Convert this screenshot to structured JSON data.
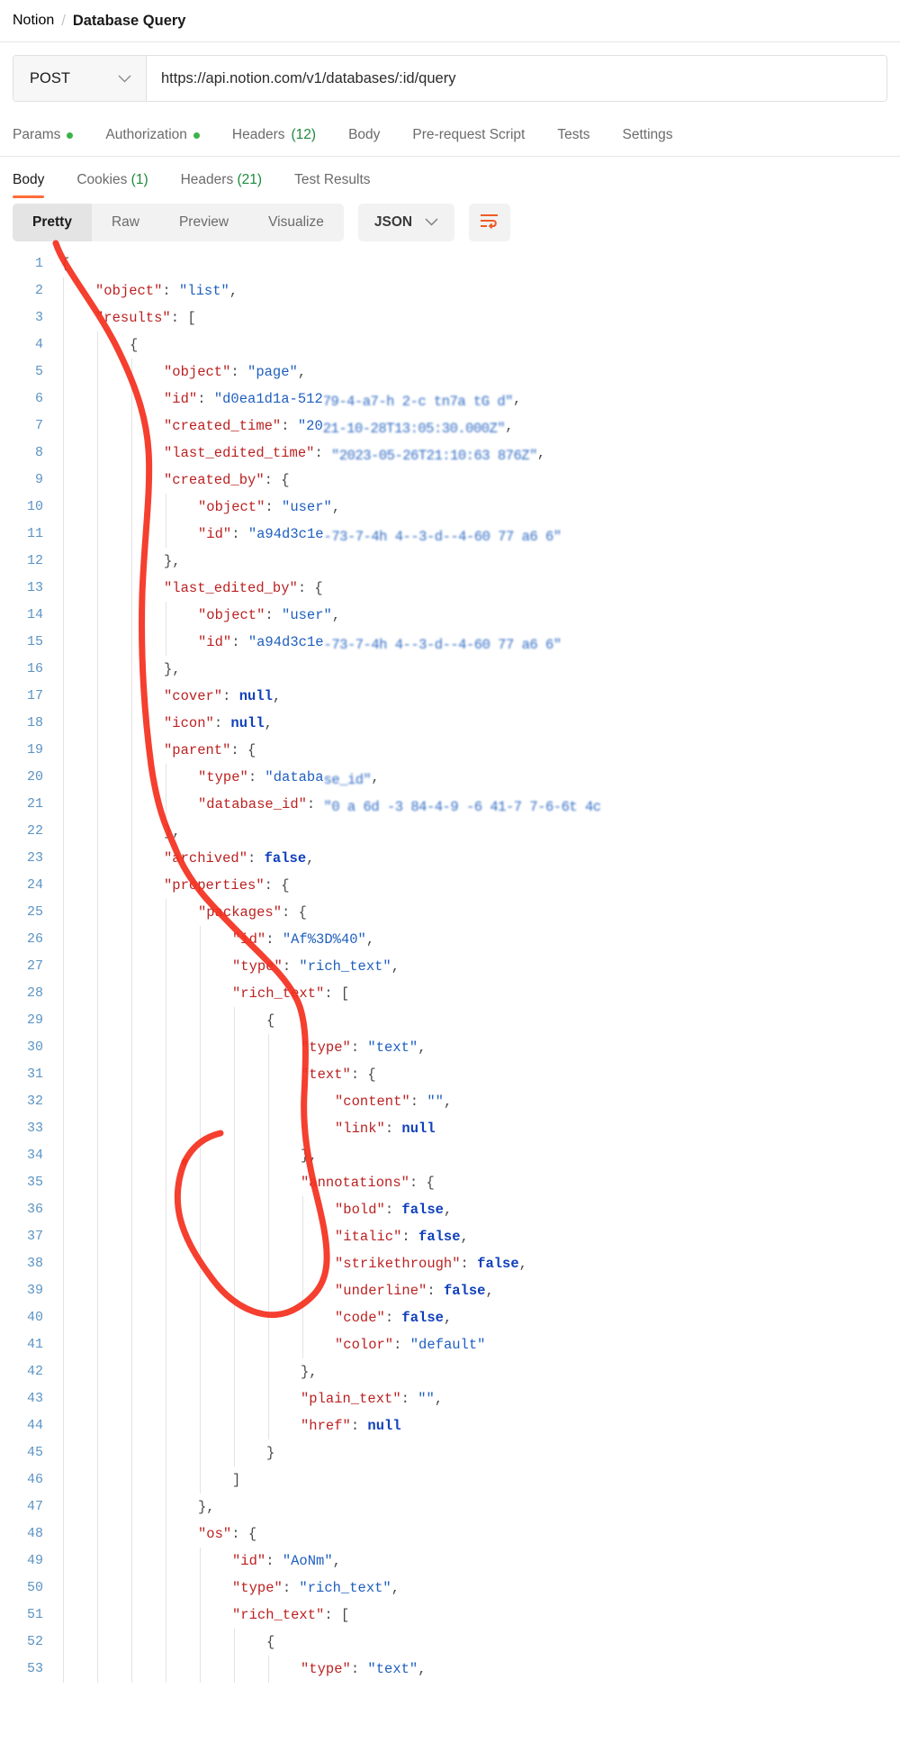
{
  "breadcrumb": {
    "root": "Notion",
    "separator": "/",
    "current": "Database Query"
  },
  "request": {
    "method": "POST",
    "method_chevron": "chevron-down-icon",
    "url": "https://api.notion.com/v1/databases/:id/query"
  },
  "request_tabs": [
    {
      "label": "Params",
      "dot": true
    },
    {
      "label": "Authorization",
      "dot": true
    },
    {
      "label": "Headers",
      "count": "(12)"
    },
    {
      "label": "Body"
    },
    {
      "label": "Pre-request Script"
    },
    {
      "label": "Tests"
    },
    {
      "label": "Settings"
    }
  ],
  "response_tabs": [
    {
      "label": "Body",
      "active": true
    },
    {
      "label": "Cookies",
      "count": "(1)"
    },
    {
      "label": "Headers",
      "count": "(21)"
    },
    {
      "label": "Test Results"
    }
  ],
  "format_toolbar": {
    "views": [
      "Pretty",
      "Raw",
      "Preview",
      "Visualize"
    ],
    "active_view": "Pretty",
    "language": "JSON",
    "language_chevron": "chevron-down-icon",
    "wrap_button": "word-wrap-icon",
    "accent": "#ff6c37"
  },
  "colors": {
    "accent": "#ff6c37",
    "key": "#bb2222",
    "string": "#1f5fbf",
    "literal": "#1040bb",
    "line_number": "#5b93c4",
    "annotation_stroke": "#f4301f"
  },
  "code": {
    "language": "JSON",
    "first_line": 1,
    "lines": [
      {
        "n": 1,
        "indent": 0,
        "tokens": [
          {
            "t": "p",
            "v": "{"
          }
        ]
      },
      {
        "n": 2,
        "indent": 1,
        "tokens": [
          {
            "t": "k",
            "v": "\"object\""
          },
          {
            "t": "p",
            "v": ": "
          },
          {
            "t": "s",
            "v": "\"list\""
          },
          {
            "t": "p",
            "v": ","
          }
        ]
      },
      {
        "n": 3,
        "indent": 1,
        "tokens": [
          {
            "t": "k",
            "v": "\"results\""
          },
          {
            "t": "p",
            "v": ": ["
          }
        ]
      },
      {
        "n": 4,
        "indent": 2,
        "tokens": [
          {
            "t": "p",
            "v": "{"
          }
        ]
      },
      {
        "n": 5,
        "indent": 3,
        "tokens": [
          {
            "t": "k",
            "v": "\"object\""
          },
          {
            "t": "p",
            "v": ": "
          },
          {
            "t": "s",
            "v": "\"page\""
          },
          {
            "t": "p",
            "v": ","
          }
        ]
      },
      {
        "n": 6,
        "indent": 3,
        "tokens": [
          {
            "t": "k",
            "v": "\"id\""
          },
          {
            "t": "p",
            "v": ": "
          },
          {
            "t": "s",
            "v": "\"d0ea1d1a-512"
          },
          {
            "t": "r",
            "v": "79-4-a7-h 2-c tn7a tG d\""
          },
          {
            "t": "p",
            "v": ","
          }
        ]
      },
      {
        "n": 7,
        "indent": 3,
        "tokens": [
          {
            "t": "k",
            "v": "\"created_time\""
          },
          {
            "t": "p",
            "v": ": "
          },
          {
            "t": "s",
            "v": "\"20"
          },
          {
            "t": "r",
            "v": "21-10-28T13:05:30.000Z\""
          },
          {
            "t": "p",
            "v": ","
          }
        ]
      },
      {
        "n": 8,
        "indent": 3,
        "tokens": [
          {
            "t": "k",
            "v": "\"last_edited_time\""
          },
          {
            "t": "p",
            "v": ": "
          },
          {
            "t": "r",
            "v": "\"2023-05-26T21:10:63 876Z\""
          },
          {
            "t": "p",
            "v": ","
          }
        ]
      },
      {
        "n": 9,
        "indent": 3,
        "tokens": [
          {
            "t": "k",
            "v": "\"created_by\""
          },
          {
            "t": "p",
            "v": ": {"
          }
        ]
      },
      {
        "n": 10,
        "indent": 4,
        "tokens": [
          {
            "t": "k",
            "v": "\"object\""
          },
          {
            "t": "p",
            "v": ": "
          },
          {
            "t": "s",
            "v": "\"user\""
          },
          {
            "t": "p",
            "v": ","
          }
        ]
      },
      {
        "n": 11,
        "indent": 4,
        "tokens": [
          {
            "t": "k",
            "v": "\"id\""
          },
          {
            "t": "p",
            "v": ": "
          },
          {
            "t": "s",
            "v": "\"a94d3c1e"
          },
          {
            "t": "r",
            "v": "-73-7-4h 4--3-d--4-60 77 a6 6\""
          }
        ]
      },
      {
        "n": 12,
        "indent": 3,
        "tokens": [
          {
            "t": "p",
            "v": "},"
          }
        ]
      },
      {
        "n": 13,
        "indent": 3,
        "tokens": [
          {
            "t": "k",
            "v": "\"last_edited_by\""
          },
          {
            "t": "p",
            "v": ": {"
          }
        ]
      },
      {
        "n": 14,
        "indent": 4,
        "tokens": [
          {
            "t": "k",
            "v": "\"object\""
          },
          {
            "t": "p",
            "v": ": "
          },
          {
            "t": "s",
            "v": "\"user\""
          },
          {
            "t": "p",
            "v": ","
          }
        ]
      },
      {
        "n": 15,
        "indent": 4,
        "tokens": [
          {
            "t": "k",
            "v": "\"id\""
          },
          {
            "t": "p",
            "v": ": "
          },
          {
            "t": "s",
            "v": "\"a94d3c1e"
          },
          {
            "t": "r",
            "v": "-73-7-4h 4--3-d--4-60 77 a6 6\""
          }
        ]
      },
      {
        "n": 16,
        "indent": 3,
        "tokens": [
          {
            "t": "p",
            "v": "},"
          }
        ]
      },
      {
        "n": 17,
        "indent": 3,
        "tokens": [
          {
            "t": "k",
            "v": "\"cover\""
          },
          {
            "t": "p",
            "v": ": "
          },
          {
            "t": "b",
            "v": "null"
          },
          {
            "t": "p",
            "v": ","
          }
        ]
      },
      {
        "n": 18,
        "indent": 3,
        "tokens": [
          {
            "t": "k",
            "v": "\"icon\""
          },
          {
            "t": "p",
            "v": ": "
          },
          {
            "t": "b",
            "v": "null"
          },
          {
            "t": "p",
            "v": ","
          }
        ]
      },
      {
        "n": 19,
        "indent": 3,
        "tokens": [
          {
            "t": "k",
            "v": "\"parent\""
          },
          {
            "t": "p",
            "v": ": {"
          }
        ]
      },
      {
        "n": 20,
        "indent": 4,
        "tokens": [
          {
            "t": "k",
            "v": "\"type\""
          },
          {
            "t": "p",
            "v": ": "
          },
          {
            "t": "s",
            "v": "\"databa"
          },
          {
            "t": "r",
            "v": "se_id\""
          },
          {
            "t": "p",
            "v": ","
          }
        ]
      },
      {
        "n": 21,
        "indent": 4,
        "tokens": [
          {
            "t": "k",
            "v": "\"database_id\""
          },
          {
            "t": "p",
            "v": ": "
          },
          {
            "t": "r",
            "v": "\"0 a 6d -3 84-4-9 -6 41-7 7-6-6t 4c"
          }
        ]
      },
      {
        "n": 22,
        "indent": 3,
        "tokens": [
          {
            "t": "p",
            "v": "},"
          }
        ]
      },
      {
        "n": 23,
        "indent": 3,
        "tokens": [
          {
            "t": "k",
            "v": "\"archived\""
          },
          {
            "t": "p",
            "v": ": "
          },
          {
            "t": "b",
            "v": "false"
          },
          {
            "t": "p",
            "v": ","
          }
        ]
      },
      {
        "n": 24,
        "indent": 3,
        "tokens": [
          {
            "t": "k",
            "v": "\"properties\""
          },
          {
            "t": "p",
            "v": ": {"
          }
        ]
      },
      {
        "n": 25,
        "indent": 4,
        "tokens": [
          {
            "t": "k",
            "v": "\"packages\""
          },
          {
            "t": "p",
            "v": ": {"
          }
        ]
      },
      {
        "n": 26,
        "indent": 5,
        "tokens": [
          {
            "t": "k",
            "v": "\"id\""
          },
          {
            "t": "p",
            "v": ": "
          },
          {
            "t": "s",
            "v": "\"Af%3D%40\""
          },
          {
            "t": "p",
            "v": ","
          }
        ]
      },
      {
        "n": 27,
        "indent": 5,
        "tokens": [
          {
            "t": "k",
            "v": "\"type\""
          },
          {
            "t": "p",
            "v": ": "
          },
          {
            "t": "s",
            "v": "\"rich_text\""
          },
          {
            "t": "p",
            "v": ","
          }
        ]
      },
      {
        "n": 28,
        "indent": 5,
        "tokens": [
          {
            "t": "k",
            "v": "\"rich_text\""
          },
          {
            "t": "p",
            "v": ": ["
          }
        ]
      },
      {
        "n": 29,
        "indent": 6,
        "tokens": [
          {
            "t": "p",
            "v": "{"
          }
        ]
      },
      {
        "n": 30,
        "indent": 7,
        "tokens": [
          {
            "t": "k",
            "v": "\"type\""
          },
          {
            "t": "p",
            "v": ": "
          },
          {
            "t": "s",
            "v": "\"text\""
          },
          {
            "t": "p",
            "v": ","
          }
        ]
      },
      {
        "n": 31,
        "indent": 7,
        "tokens": [
          {
            "t": "k",
            "v": "\"text\""
          },
          {
            "t": "p",
            "v": ": {"
          }
        ]
      },
      {
        "n": 32,
        "indent": 8,
        "tokens": [
          {
            "t": "k",
            "v": "\"content\""
          },
          {
            "t": "p",
            "v": ": "
          },
          {
            "t": "s",
            "v": "\"\""
          },
          {
            "t": "p",
            "v": ","
          }
        ]
      },
      {
        "n": 33,
        "indent": 8,
        "tokens": [
          {
            "t": "k",
            "v": "\"link\""
          },
          {
            "t": "p",
            "v": ": "
          },
          {
            "t": "b",
            "v": "null"
          }
        ]
      },
      {
        "n": 34,
        "indent": 7,
        "tokens": [
          {
            "t": "p",
            "v": "},"
          }
        ]
      },
      {
        "n": 35,
        "indent": 7,
        "tokens": [
          {
            "t": "k",
            "v": "\"annotations\""
          },
          {
            "t": "p",
            "v": ": {"
          }
        ]
      },
      {
        "n": 36,
        "indent": 8,
        "tokens": [
          {
            "t": "k",
            "v": "\"bold\""
          },
          {
            "t": "p",
            "v": ": "
          },
          {
            "t": "b",
            "v": "false"
          },
          {
            "t": "p",
            "v": ","
          }
        ]
      },
      {
        "n": 37,
        "indent": 8,
        "tokens": [
          {
            "t": "k",
            "v": "\"italic\""
          },
          {
            "t": "p",
            "v": ": "
          },
          {
            "t": "b",
            "v": "false"
          },
          {
            "t": "p",
            "v": ","
          }
        ]
      },
      {
        "n": 38,
        "indent": 8,
        "tokens": [
          {
            "t": "k",
            "v": "\"strikethrough\""
          },
          {
            "t": "p",
            "v": ": "
          },
          {
            "t": "b",
            "v": "false"
          },
          {
            "t": "p",
            "v": ","
          }
        ]
      },
      {
        "n": 39,
        "indent": 8,
        "tokens": [
          {
            "t": "k",
            "v": "\"underline\""
          },
          {
            "t": "p",
            "v": ": "
          },
          {
            "t": "b",
            "v": "false"
          },
          {
            "t": "p",
            "v": ","
          }
        ]
      },
      {
        "n": 40,
        "indent": 8,
        "tokens": [
          {
            "t": "k",
            "v": "\"code\""
          },
          {
            "t": "p",
            "v": ": "
          },
          {
            "t": "b",
            "v": "false"
          },
          {
            "t": "p",
            "v": ","
          }
        ]
      },
      {
        "n": 41,
        "indent": 8,
        "tokens": [
          {
            "t": "k",
            "v": "\"color\""
          },
          {
            "t": "p",
            "v": ": "
          },
          {
            "t": "s",
            "v": "\"default\""
          }
        ]
      },
      {
        "n": 42,
        "indent": 7,
        "tokens": [
          {
            "t": "p",
            "v": "},"
          }
        ]
      },
      {
        "n": 43,
        "indent": 7,
        "tokens": [
          {
            "t": "k",
            "v": "\"plain_text\""
          },
          {
            "t": "p",
            "v": ": "
          },
          {
            "t": "s",
            "v": "\"\""
          },
          {
            "t": "p",
            "v": ","
          }
        ]
      },
      {
        "n": 44,
        "indent": 7,
        "tokens": [
          {
            "t": "k",
            "v": "\"href\""
          },
          {
            "t": "p",
            "v": ": "
          },
          {
            "t": "b",
            "v": "null"
          }
        ]
      },
      {
        "n": 45,
        "indent": 6,
        "tokens": [
          {
            "t": "p",
            "v": "}"
          }
        ]
      },
      {
        "n": 46,
        "indent": 5,
        "tokens": [
          {
            "t": "p",
            "v": "]"
          }
        ]
      },
      {
        "n": 47,
        "indent": 4,
        "tokens": [
          {
            "t": "p",
            "v": "},"
          }
        ]
      },
      {
        "n": 48,
        "indent": 4,
        "tokens": [
          {
            "t": "k",
            "v": "\"os\""
          },
          {
            "t": "p",
            "v": ": {"
          }
        ]
      },
      {
        "n": 49,
        "indent": 5,
        "tokens": [
          {
            "t": "k",
            "v": "\"id\""
          },
          {
            "t": "p",
            "v": ": "
          },
          {
            "t": "s",
            "v": "\"AoNm\""
          },
          {
            "t": "p",
            "v": ","
          }
        ]
      },
      {
        "n": 50,
        "indent": 5,
        "tokens": [
          {
            "t": "k",
            "v": "\"type\""
          },
          {
            "t": "p",
            "v": ": "
          },
          {
            "t": "s",
            "v": "\"rich_text\""
          },
          {
            "t": "p",
            "v": ","
          }
        ]
      },
      {
        "n": 51,
        "indent": 5,
        "tokens": [
          {
            "t": "k",
            "v": "\"rich_text\""
          },
          {
            "t": "p",
            "v": ": ["
          }
        ]
      },
      {
        "n": 52,
        "indent": 6,
        "tokens": [
          {
            "t": "p",
            "v": "{"
          }
        ]
      },
      {
        "n": 53,
        "indent": 7,
        "tokens": [
          {
            "t": "k",
            "v": "\"type\""
          },
          {
            "t": "p",
            "v": ": "
          },
          {
            "t": "s",
            "v": "\"text\""
          },
          {
            "t": "p",
            "v": ","
          }
        ]
      }
    ]
  }
}
